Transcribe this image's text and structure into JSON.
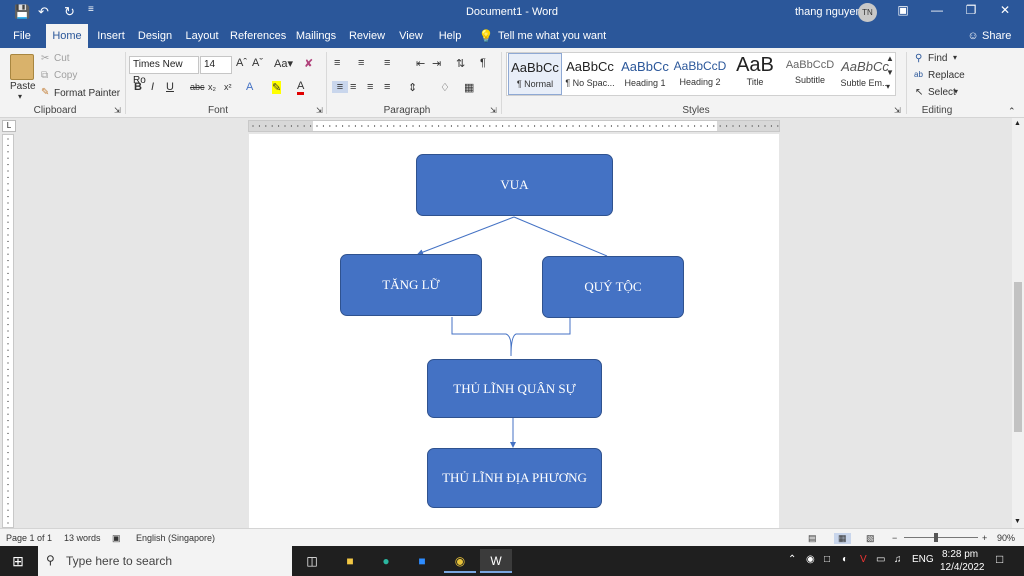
{
  "window": {
    "title": "Document1  -  Word",
    "user_name": "thang nguyen",
    "user_initials": "TN",
    "help_icon": "ribbon-display-options-icon"
  },
  "tabs": [
    "File",
    "Home",
    "Insert",
    "Design",
    "Layout",
    "References",
    "Mailings",
    "Review",
    "View",
    "Help"
  ],
  "tell_me": "Tell me what you want to do",
  "share": "Share",
  "clipboard": {
    "paste": "Paste",
    "cut": "Cut",
    "copy": "Copy",
    "format_painter": "Format Painter",
    "label": "Clipboard"
  },
  "font": {
    "name": "Times New Ro",
    "size": "14",
    "label": "Font"
  },
  "paragraph": {
    "label": "Paragraph"
  },
  "styles": {
    "label": "Styles",
    "items": [
      {
        "preview": "AaBbCc",
        "name": "¶ Normal"
      },
      {
        "preview": "AaBbCc",
        "name": "¶ No Spac..."
      },
      {
        "preview": "AaBbCc",
        "name": "Heading 1"
      },
      {
        "preview": "AaBbCcD",
        "name": "Heading 2"
      },
      {
        "preview": "AaB",
        "name": "Title"
      },
      {
        "preview": "AaBbCcD",
        "name": "Subtitle"
      },
      {
        "preview": "AaBbCc",
        "name": "Subtle Em..."
      }
    ]
  },
  "editing": {
    "find": "Find",
    "replace": "Replace",
    "select": "Select",
    "label": "Editing"
  },
  "diagram": {
    "top": "VUA",
    "left": "TĂNG LỮ",
    "right": "QUÝ TỘC",
    "middle": "THỦ LĨNH QUÂN SỰ",
    "bottom": "THỦ LĨNH ĐỊA PHƯƠNG"
  },
  "status": {
    "page": "Page 1 of 1",
    "words": "13 words",
    "language": "English (Singapore)",
    "zoom": "90%"
  },
  "taskbar": {
    "search_placeholder": "Type here to search",
    "language": "ENG",
    "time": "8:28 pm",
    "date": "12/4/2022"
  },
  "colors": {
    "word_blue": "#2b579a",
    "shape_fill": "#4472c4",
    "shape_border": "#2f528f"
  }
}
